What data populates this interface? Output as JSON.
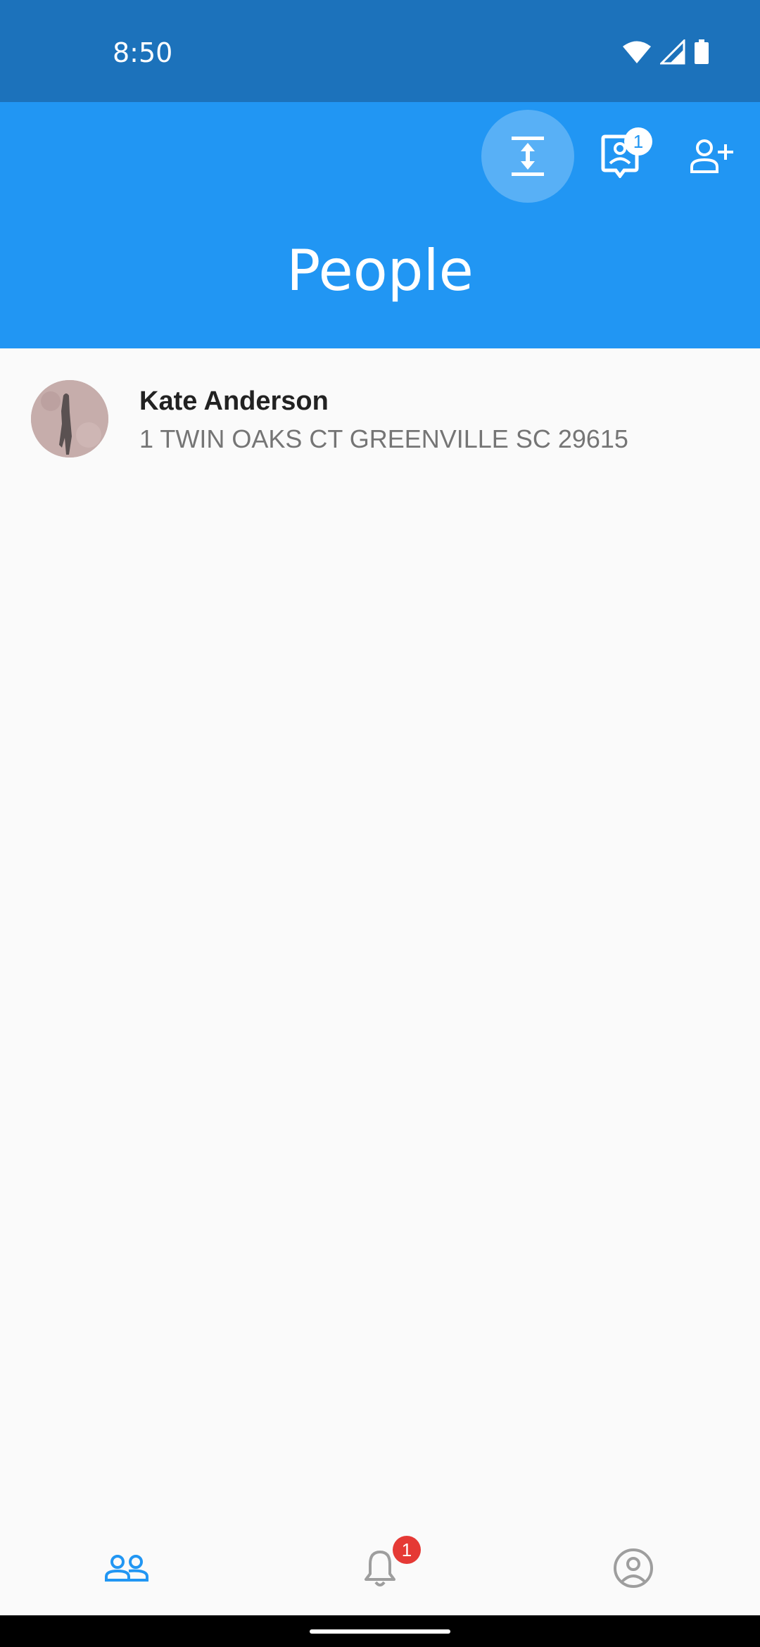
{
  "status_bar": {
    "time": "8:50",
    "icons": [
      "wifi-icon",
      "cell-signal-icon",
      "battery-icon"
    ]
  },
  "app_bar": {
    "title": "People",
    "actions": [
      {
        "icon": "expand-vertical-icon",
        "active": true
      },
      {
        "icon": "contact-card-icon",
        "badge": "1"
      },
      {
        "icon": "add-person-icon"
      }
    ]
  },
  "people": [
    {
      "name": "Kate Anderson",
      "address": "1 TWIN OAKS CT GREENVILLE SC 29615"
    }
  ],
  "bottom_nav": {
    "items": [
      {
        "icon": "people-icon",
        "selected": true
      },
      {
        "icon": "bell-icon",
        "badge": "1"
      },
      {
        "icon": "account-circle-icon"
      }
    ]
  },
  "colors": {
    "status_bar": "#1c72bb",
    "app_bar": "#2196f3",
    "badge": "#e53935",
    "inactive_icon": "#9e9e9e"
  }
}
